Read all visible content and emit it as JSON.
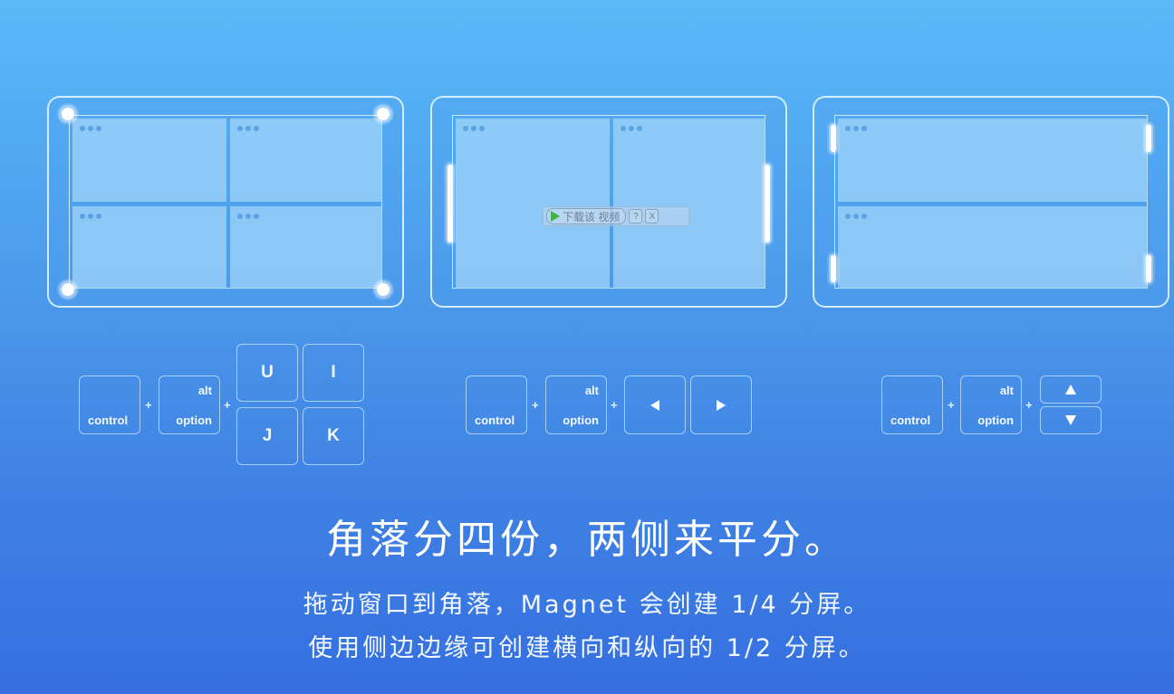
{
  "panels": [
    {
      "id": "quarters",
      "description": "four corner quarters",
      "windows": 4,
      "handles": "corner"
    },
    {
      "id": "halves-vertical",
      "description": "left and right halves",
      "windows": 2,
      "handles": "side"
    },
    {
      "id": "halves-horizontal",
      "description": "top and bottom halves",
      "windows": 2,
      "handles": "edge-ends"
    }
  ],
  "overlay": {
    "download_label": "下载该 视频",
    "help_label": "?",
    "close_label": "X"
  },
  "shortcuts": {
    "control": "control",
    "alt": "alt",
    "option": "option",
    "plus": "+",
    "quarters_keys": [
      "U",
      "I",
      "J",
      "K"
    ],
    "halves_keys": [
      "left-arrow",
      "right-arrow"
    ],
    "vertical_keys": [
      "up-arrow",
      "down-arrow"
    ]
  },
  "text": {
    "headline": "角落分四份，两侧来平分。",
    "line1": "拖动窗口到角落，Magnet 会创建 1/4 分屏。",
    "line2": "使用侧边边缘可创建横向和纵向的 1/2 分屏。"
  },
  "colors": {
    "background_top": "#5bbaf8",
    "background_bottom": "#356fe0",
    "window_fill": "#a5d7fa",
    "dot": "#5aa4e6",
    "play_green": "#43b04a"
  }
}
